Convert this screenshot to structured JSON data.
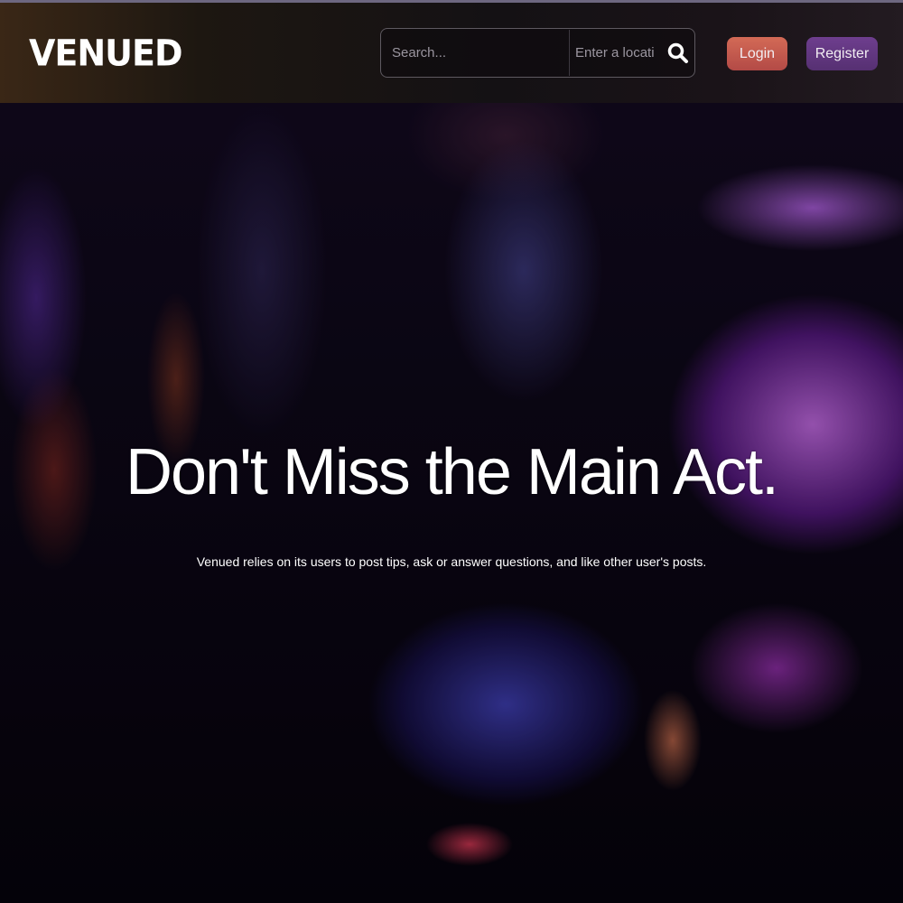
{
  "brand": {
    "logo_text": "VENUED"
  },
  "navbar": {
    "search_placeholder": "Search...",
    "location_placeholder": "Enter a location",
    "search_icon": "search-icon",
    "login_label": "Login",
    "register_label": "Register"
  },
  "hero": {
    "headline": "Don't Miss the Main Act.",
    "subtext": "Venued relies on its users to post tips, ask or answer questions, and like other user's posts."
  },
  "colors": {
    "login_button": "#c85a4f",
    "register_button": "#623780",
    "accent_purple": "#b44cff"
  }
}
